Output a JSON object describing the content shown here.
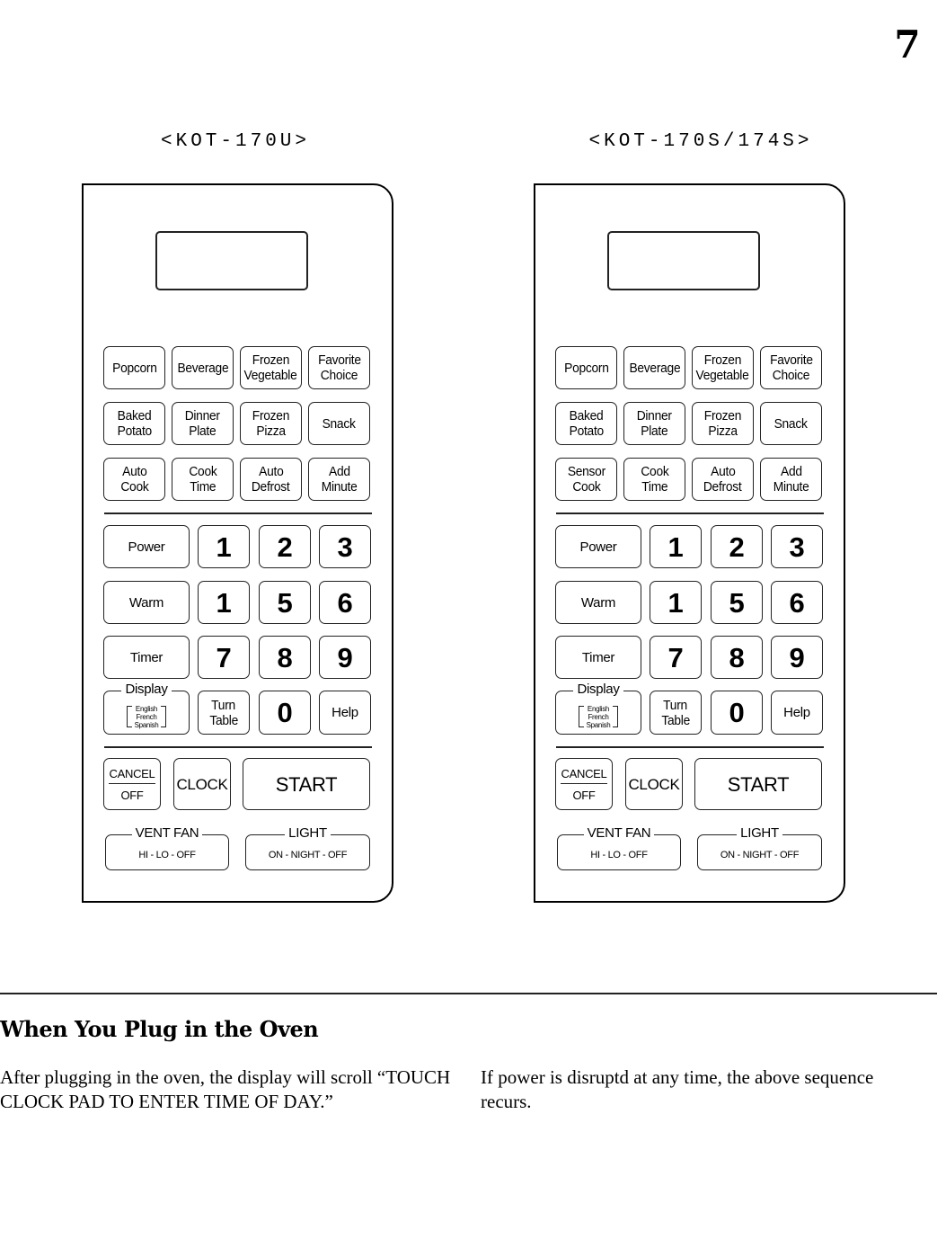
{
  "page": {
    "number": "7"
  },
  "panels": [
    {
      "model": "<KOT-170U>",
      "programs": [
        [
          "Popcorn",
          ""
        ],
        [
          "Beverage",
          ""
        ],
        [
          "Frozen",
          "Vegetable"
        ],
        [
          "Favorite",
          "Choice"
        ],
        [
          "Baked",
          "Potato"
        ],
        [
          "Dinner",
          "Plate"
        ],
        [
          "Frozen",
          "Pizza"
        ],
        [
          "Snack",
          ""
        ],
        [
          "Auto",
          "Cook"
        ],
        [
          "Cook",
          "Time"
        ],
        [
          "Auto",
          "Defrost"
        ],
        [
          "Add",
          "Minute"
        ]
      ],
      "function_keys": [
        "Power",
        "Warm",
        "Timer"
      ],
      "digits": [
        "1",
        "2",
        "3",
        "1",
        "5",
        "6",
        "7",
        "8",
        "9"
      ],
      "display_key": {
        "title": "Display",
        "languages": [
          "English",
          "French",
          "Spanish"
        ]
      },
      "turn_table": [
        "Turn",
        "Table"
      ],
      "zero": "0",
      "help": "Help",
      "cancel": {
        "top": "CANCEL",
        "bottom": "OFF"
      },
      "clock": "CLOCK",
      "start": "START",
      "vent_fan": {
        "title": "VENT FAN",
        "options": "HI - LO - OFF"
      },
      "light": {
        "title": "LIGHT",
        "options": "ON - NIGHT - OFF"
      }
    },
    {
      "model": "<KOT-170S/174S>",
      "programs": [
        [
          "Popcorn",
          ""
        ],
        [
          "Beverage",
          ""
        ],
        [
          "Frozen",
          "Vegetable"
        ],
        [
          "Favorite",
          "Choice"
        ],
        [
          "Baked",
          "Potato"
        ],
        [
          "Dinner",
          "Plate"
        ],
        [
          "Frozen",
          "Pizza"
        ],
        [
          "Snack",
          ""
        ],
        [
          "Sensor",
          "Cook"
        ],
        [
          "Cook",
          "Time"
        ],
        [
          "Auto",
          "Defrost"
        ],
        [
          "Add",
          "Minute"
        ]
      ],
      "function_keys": [
        "Power",
        "Warm",
        "Timer"
      ],
      "digits": [
        "1",
        "2",
        "3",
        "1",
        "5",
        "6",
        "7",
        "8",
        "9"
      ],
      "display_key": {
        "title": "Display",
        "languages": [
          "English",
          "French",
          "Spanish"
        ]
      },
      "turn_table": [
        "Turn",
        "Table"
      ],
      "zero": "0",
      "help": "Help",
      "cancel": {
        "top": "CANCEL",
        "bottom": "OFF"
      },
      "clock": "CLOCK",
      "start": "START",
      "vent_fan": {
        "title": "VENT FAN",
        "options": "HI - LO - OFF"
      },
      "light": {
        "title": "LIGHT",
        "options": "ON - NIGHT - OFF"
      }
    }
  ],
  "section": {
    "title": "When You Plug in the Oven",
    "paragraph_left": "After plugging in the oven, the display will scroll “TOUCH CLOCK PAD TO ENTER TIME OF DAY.”",
    "paragraph_right": "If power is disruptd at any time, the above sequence recurs."
  }
}
